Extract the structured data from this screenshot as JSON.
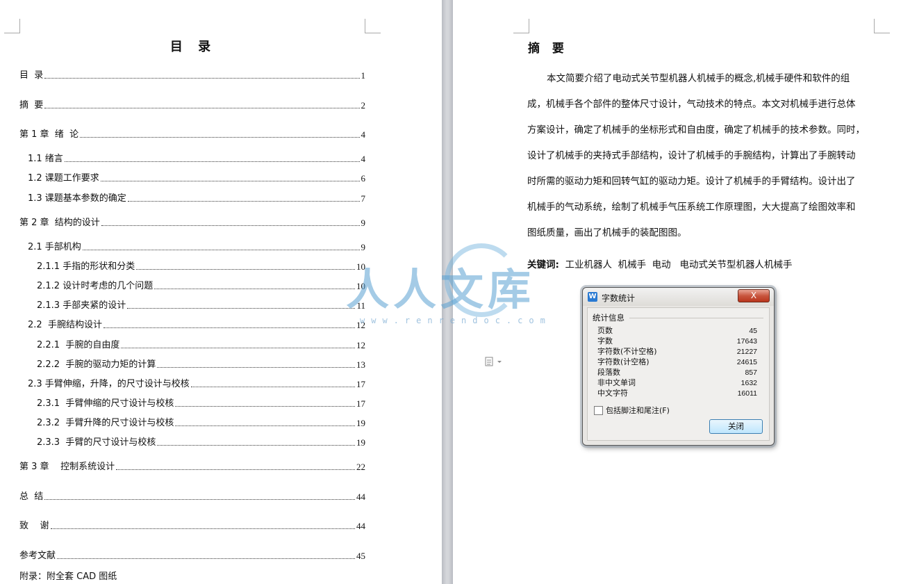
{
  "left_page": {
    "title": "目 录",
    "toc": [
      {
        "label": "目  录",
        "page": "1"
      },
      {
        "label": "摘  要",
        "page": "2"
      },
      {
        "label": "第 1 章  绪  论",
        "page": "4"
      },
      {
        "label": "1.1 绪言",
        "page": "4"
      },
      {
        "label": "1.2 课题工作要求",
        "page": "6"
      },
      {
        "label": "1.3 课题基本参数的确定",
        "page": "7"
      },
      {
        "label": "第 2 章  结构的设计",
        "page": "9"
      },
      {
        "label": "2.1 手部机构",
        "page": "9"
      },
      {
        "label": "2.1.1 手指的形状和分类",
        "page": "10"
      },
      {
        "label": "2.1.2 设计时考虑的几个问题",
        "page": "10"
      },
      {
        "label": "2.1.3 手部夹紧的设计",
        "page": "11"
      },
      {
        "label": "2.2  手腕结构设计",
        "page": "12"
      },
      {
        "label": "2.2.1  手腕的自由度",
        "page": "12"
      },
      {
        "label": "2.2.2  手腕的驱动力矩的计算",
        "page": "13"
      },
      {
        "label": "2.3 手臂伸缩，升降，的尺寸设计与校核",
        "page": "17"
      },
      {
        "label": "2.3.1  手臂伸缩的尺寸设计与校核",
        "page": "17"
      },
      {
        "label": "2.3.2  手臂升降的尺寸设计与校核",
        "page": "19"
      },
      {
        "label": "2.3.3  手臂的尺寸设计与校核",
        "page": "19"
      },
      {
        "label": "第 3 章    控制系统设计",
        "page": "22"
      },
      {
        "label": "总  结",
        "page": "44"
      },
      {
        "label": "致    谢",
        "page": "44"
      },
      {
        "label": "参考文献",
        "page": "45"
      }
    ],
    "appendix": "附录：附全套 CAD 图纸"
  },
  "right_page": {
    "title": "摘  要",
    "abstract_lines": [
      "本文简要介绍了电动式关节型机器人机械手的概念,机械手硬件和软件的组",
      "成，机械手各个部件的整体尺寸设计，气动技术的特点。本文对机械手进行总体",
      "方案设计，确定了机械手的坐标形式和自由度，确定了机械手的技术参数。同时，",
      "设计了机械手的夹持式手部结构，设计了机械手的手腕结构，计算出了手腕转动",
      "时所需的驱动力矩和回转气缸的驱动力矩。设计了机械手的手臂结构。设计出了",
      "机械手的气动系统，绘制了机械手气压系统工作原理图，大大提高了绘图效率和",
      "图纸质量，画出了机械手的装配图图。"
    ],
    "keywords_label": "关键词:",
    "keywords_text": "工业机器人  机械手  电动   电动式关节型机器人机械手"
  },
  "watermark": {
    "text": "人人文库",
    "url": "www.renrendoc.com"
  },
  "dialog": {
    "app_icon": "W",
    "title": "字数统计",
    "close_x": "X",
    "group_label": "统计信息",
    "stats": [
      {
        "label": "页数",
        "value": "45"
      },
      {
        "label": "字数",
        "value": "17643"
      },
      {
        "label": "字符数(不计空格)",
        "value": "21227"
      },
      {
        "label": "字符数(计空格)",
        "value": "24615"
      },
      {
        "label": "段落数",
        "value": "857"
      },
      {
        "label": "非中文单词",
        "value": "1632"
      },
      {
        "label": "中文字符",
        "value": "16011"
      }
    ],
    "checkbox_label": "包括脚注和尾注(F)",
    "checkbox_checked": false,
    "close_button": "关闭"
  }
}
